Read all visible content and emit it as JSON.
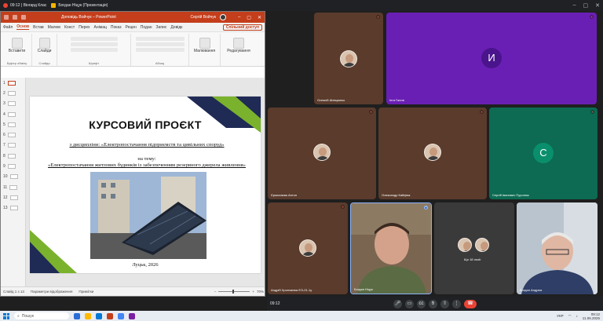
{
  "meet_top": {
    "tabs": [
      {
        "label": "09:12 | Вінгард Клас"
      },
      {
        "label": "Богдан Ніцук (Презентація)"
      }
    ]
  },
  "ppt": {
    "doc_title": "Доповідь Войчук  –  PowerPoint",
    "user_name": "Сергій Войчук",
    "tabs": [
      "Файл",
      "Основ",
      "Встав",
      "Малюв",
      "Конст",
      "Перех",
      "Анімац",
      "Показ",
      "Рецен",
      "Подан",
      "Запис",
      "Довідк"
    ],
    "active_tab": "Основ",
    "share_label": "Спільний доступ",
    "ribbon_groups": [
      {
        "label": "Буфер обміну",
        "button": "Вставити"
      },
      {
        "label": "Слайди",
        "button": "Слайди"
      },
      {
        "label": "Шрифт"
      },
      {
        "label": "Абзац"
      },
      {
        "label": "",
        "button": "Малювання"
      },
      {
        "label": "",
        "button": "Редагування"
      }
    ],
    "slide_numbers": [
      "1",
      "2",
      "3",
      "4",
      "5",
      "6",
      "7",
      "8",
      "9",
      "10",
      "11",
      "12",
      "13"
    ],
    "selected_slide": 1,
    "slide": {
      "title": "КУРСОВИЙ ПРОЄКТ",
      "discipline": "з дисципліни: «Електропостачання підприємств та цивільних споруд»",
      "on_topic": "на тему:",
      "topic": "«Електропостачання житлових будинків із забезпеченням резервного джерела живлення»",
      "city_year": "Луцьк, 2026"
    },
    "status": {
      "slide_of": "Слайд 1 з 13",
      "view_params": "Параметри відображення",
      "notes": "Примітки",
      "zoom": "70%"
    }
  },
  "meet": {
    "tiles": [
      {
        "name": "Олексій Шевцюнко",
        "bg": "#5a3b2c"
      },
      {
        "name": "Інга Гапов",
        "bg": "#6a1fb4",
        "initial": "И",
        "initial_bg": "#4a148c"
      },
      {
        "name": "Єрмолаєва Антон",
        "bg": "#5a3b2c"
      },
      {
        "name": "Олександр Кайфюк",
        "bg": "#5a3b2c"
      },
      {
        "name": "Сергій Іванович Пуронюк",
        "bg": "#0c6b52",
        "initial": "С",
        "initial_bg": "#0a8f6c"
      },
      {
        "name": "Андрій Хропчанюк ЕЭ-21-1у",
        "bg": "#5a3b2c"
      },
      {
        "name": "Богдан Ніцук",
        "bg": "#6b5a48"
      },
      {
        "name": "Що 18 osob",
        "bg": "#3a3a3a"
      },
      {
        "name": "Богдан Андрюк",
        "bg": "#9aa7b5"
      }
    ],
    "time": "09:12",
    "controls": [
      "mic",
      "cam",
      "cc",
      "hand",
      "present",
      "more",
      "end"
    ]
  },
  "taskbar": {
    "search": "Пошук",
    "clock_time": "09:12",
    "clock_date": "11.06.2026",
    "lang": "УКР"
  }
}
